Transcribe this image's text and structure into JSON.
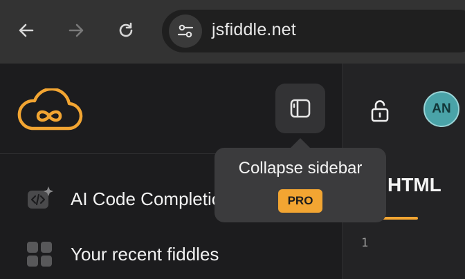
{
  "browser": {
    "url": "jsfiddle.net",
    "icons": {
      "back": "arrow-left-icon",
      "forward": "arrow-right-icon",
      "reload": "reload-icon",
      "site_info": "tune-icon"
    }
  },
  "app": {
    "logo": "jsfiddle-cloud-logo",
    "accent_color": "#f2a532",
    "header": {
      "collapse_icon": "sidebar-panel-icon",
      "lock_icon": "unlock-icon",
      "avatar_initials": "AN"
    },
    "sidebar": {
      "items": [
        {
          "label": "AI Code Completion",
          "icon": "ai-code-icon"
        },
        {
          "label": "Your recent fiddles",
          "icon": "grid-icon"
        }
      ]
    },
    "editor": {
      "tab_label": "HTML",
      "line_number": "1"
    },
    "tooltip": {
      "text": "Collapse sidebar",
      "badge": "PRO"
    }
  }
}
